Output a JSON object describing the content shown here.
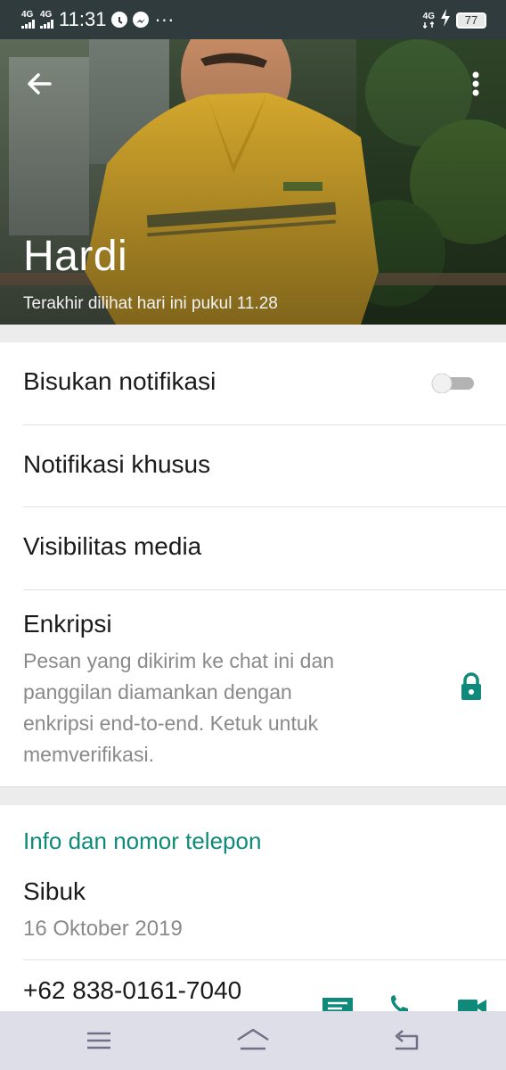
{
  "status_bar": {
    "sim1": "4G",
    "sim2": "4G",
    "time": "11:31",
    "more": "···",
    "net": "4G",
    "battery": "77",
    "icons": [
      "signal-icon",
      "clock-icon",
      "messenger-icon",
      "wifi-icon",
      "charging-icon",
      "battery-icon"
    ]
  },
  "header": {
    "name": "Hardi",
    "last_seen": "Terakhir dilihat hari ini pukul 11.28"
  },
  "settings": {
    "mute_label": "Bisukan notifikasi",
    "mute_enabled": false,
    "custom_notifications_label": "Notifikasi khusus",
    "media_visibility_label": "Visibilitas media",
    "encryption_label": "Enkripsi",
    "encryption_lines": [
      "Pesan yang dikirim ke chat ini dan",
      "panggilan diamankan dengan",
      "enkripsi end-to-end. Ketuk untuk",
      "memverifikasi."
    ]
  },
  "info": {
    "section_title": "Info dan nomor telepon",
    "about": "Sibuk",
    "about_date": "16 Oktober 2019",
    "phone": "+62 838-0161-7040"
  },
  "colors": {
    "accent": "#0f8a7a",
    "status_bar": "#2f3b3d",
    "nav_bar": "#dedee9"
  }
}
